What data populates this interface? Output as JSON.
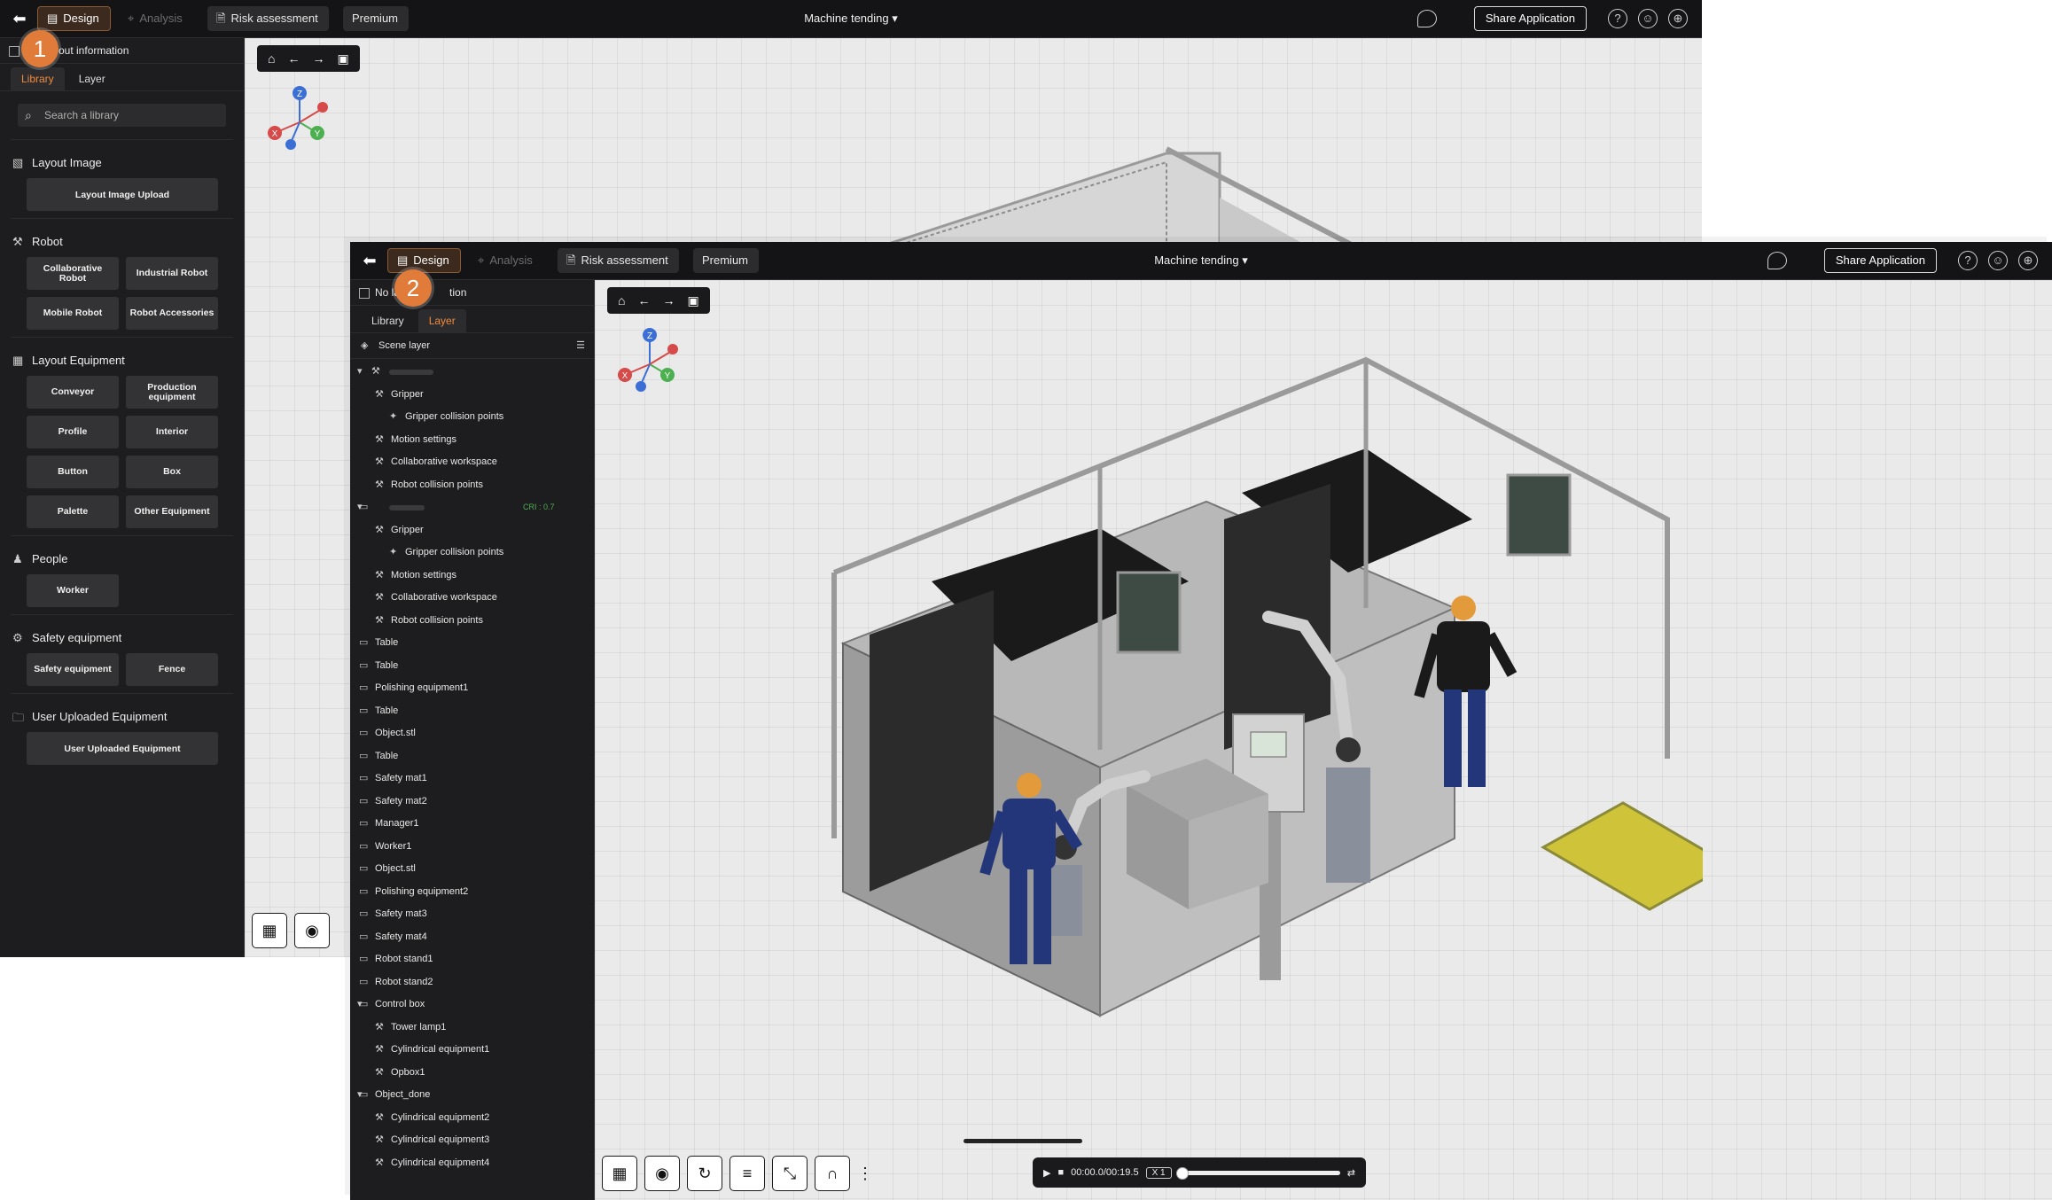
{
  "common": {
    "tabs": {
      "design": "Design",
      "analysis": "Analysis",
      "risk": "Risk assessment",
      "premium": "Premium"
    },
    "project_title": "Machine tending",
    "share_label": "Share Application"
  },
  "win1": {
    "badge": "1",
    "info_label": "out information",
    "tabs": [
      "Library",
      "Layer"
    ],
    "search_placeholder": "Search a library",
    "sections": {
      "layout_image": {
        "title": "Layout Image",
        "items": [
          "Layout Image Upload"
        ]
      },
      "robot": {
        "title": "Robot",
        "items": [
          "Collaborative Robot",
          "Industrial Robot",
          "Mobile Robot",
          "Robot Accessories"
        ]
      },
      "layout_equipment": {
        "title": "Layout Equipment",
        "items": [
          "Conveyor",
          "Production equipment",
          "Profile",
          "Interior",
          "Button",
          "Box",
          "Palette",
          "Other Equipment"
        ]
      },
      "people": {
        "title": "People",
        "items": [
          "Worker"
        ]
      },
      "safety": {
        "title": "Safety equipment",
        "items": [
          "Safety equipment",
          "Fence"
        ]
      },
      "uploaded": {
        "title": "User Uploaded Equipment",
        "items": [
          "User Uploaded Equipment"
        ]
      }
    }
  },
  "win2": {
    "badge": "2",
    "info_label_a": "No layout",
    "info_label_b": "tion",
    "tabs": [
      "Library",
      "Layer"
    ],
    "scene_layer": "Scene layer",
    "cri": "CRI : 0.7",
    "layers": [
      {
        "label": "Gripper",
        "level": 2
      },
      {
        "label": "Gripper collision points",
        "level": 3
      },
      {
        "label": "Motion settings",
        "level": 2
      },
      {
        "label": "Collaborative workspace",
        "level": 2
      },
      {
        "label": "Robot collision points",
        "level": 2
      },
      {
        "label": "",
        "level": 1,
        "expand": true,
        "cri": true
      },
      {
        "label": "Gripper",
        "level": 2
      },
      {
        "label": "Gripper collision points",
        "level": 3
      },
      {
        "label": "Motion settings",
        "level": 2
      },
      {
        "label": "Collaborative workspace",
        "level": 2
      },
      {
        "label": "Robot collision points",
        "level": 2
      },
      {
        "label": "Table",
        "level": 1
      },
      {
        "label": "Table",
        "level": 1
      },
      {
        "label": "Polishing equipment1",
        "level": 1
      },
      {
        "label": "Table",
        "level": 1
      },
      {
        "label": "Object.stl",
        "level": 1
      },
      {
        "label": "Table",
        "level": 1
      },
      {
        "label": "Safety mat1",
        "level": 1
      },
      {
        "label": "Safety mat2",
        "level": 1
      },
      {
        "label": "Manager1",
        "level": 1
      },
      {
        "label": "Worker1",
        "level": 1
      },
      {
        "label": "Object.stl",
        "level": 1
      },
      {
        "label": "Polishing equipment2",
        "level": 1
      },
      {
        "label": "Safety mat3",
        "level": 1
      },
      {
        "label": "Safety mat4",
        "level": 1
      },
      {
        "label": "Robot stand1",
        "level": 1
      },
      {
        "label": "Robot stand2",
        "level": 1
      },
      {
        "label": "Control box",
        "level": 1,
        "expand": true
      },
      {
        "label": "Tower lamp1",
        "level": 2
      },
      {
        "label": "Cylindrical equipment1",
        "level": 2
      },
      {
        "label": "Opbox1",
        "level": 2
      },
      {
        "label": "Object_done",
        "level": 1,
        "expand": true
      },
      {
        "label": "Cylindrical equipment2",
        "level": 2
      },
      {
        "label": "Cylindrical equipment3",
        "level": 2
      },
      {
        "label": "Cylindrical equipment4",
        "level": 2
      }
    ],
    "player": {
      "time": "00:00.0/00:19.5",
      "speed": "X 1",
      "progress": 0
    }
  }
}
